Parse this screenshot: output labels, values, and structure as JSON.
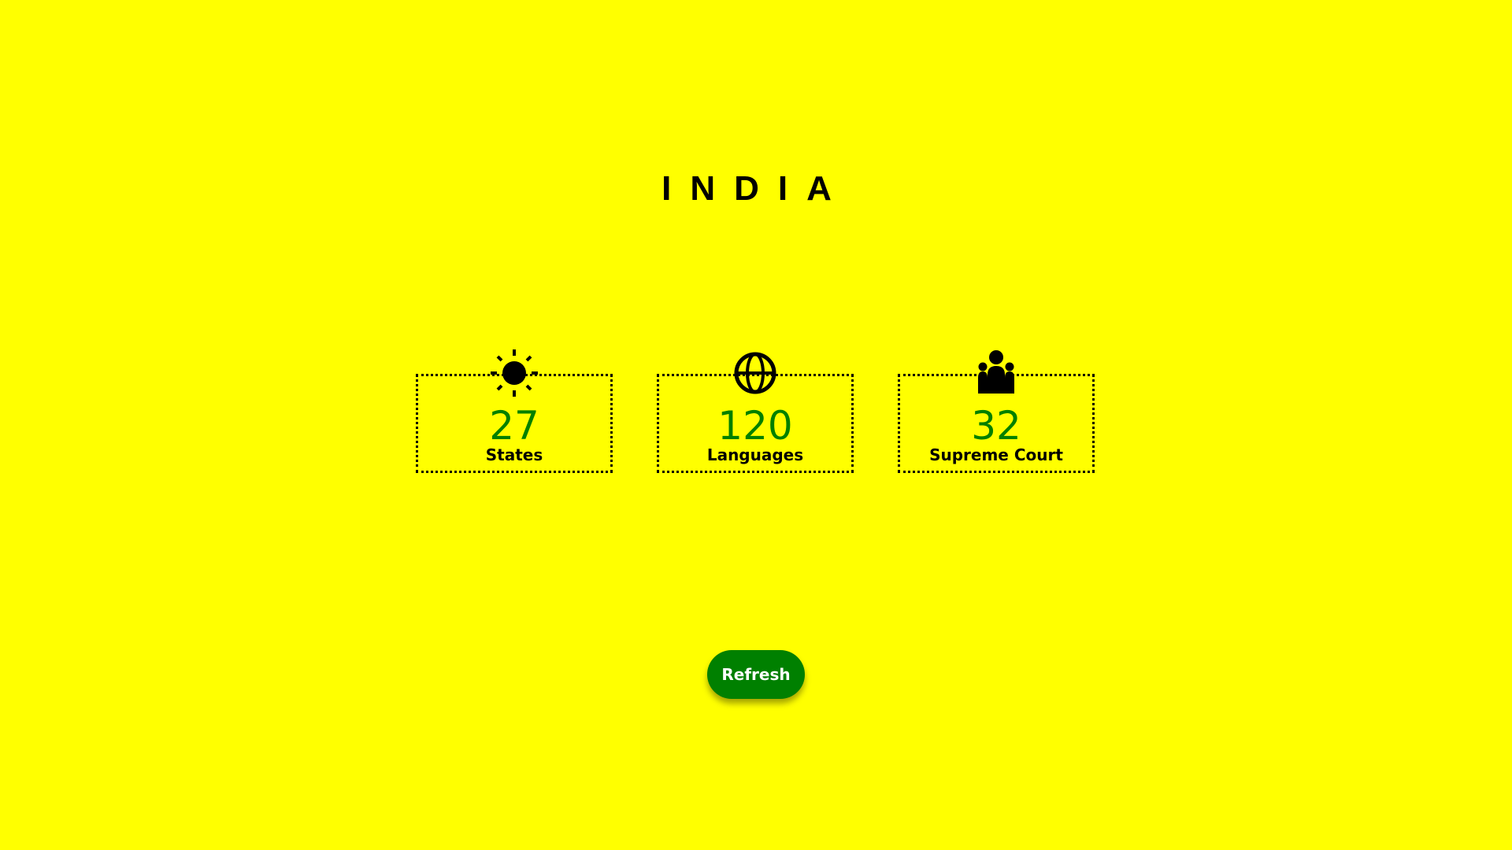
{
  "page": {
    "title": "INDIA",
    "background_color": "#ffff00",
    "accent_color": "#008000"
  },
  "stats": [
    {
      "icon": "sun-icon",
      "value": "27",
      "label": "States"
    },
    {
      "icon": "globe-icon",
      "value": "120",
      "label": "Languages"
    },
    {
      "icon": "people-group-icon",
      "value": "32",
      "label": "Supreme Court"
    }
  ],
  "actions": {
    "refresh_label": "Refresh"
  }
}
